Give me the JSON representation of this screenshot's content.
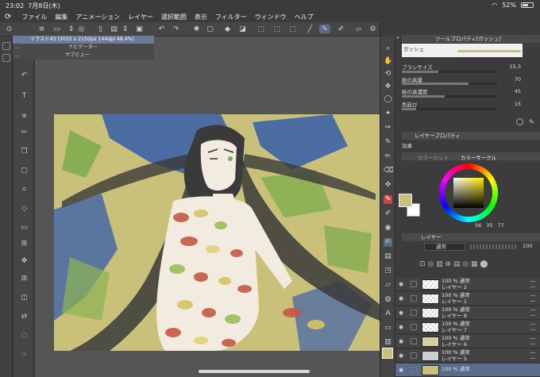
{
  "status": {
    "time": "23:02",
    "date": "7月8日(木)",
    "battery": "52%",
    "battery_level": 0.52
  },
  "menu": [
    "ファイル",
    "編集",
    "アニメーション",
    "レイヤー",
    "選択範囲",
    "表示",
    "フィルター",
    "ウィンドウ",
    "ヘルプ"
  ],
  "document_menu": {
    "active": "イラスト43 (3035 x 2150px 144dpi 48.4%)",
    "navigator": "ナビゲーター",
    "subview": "サブビュー",
    "ellipsis": "..."
  },
  "tool_property": {
    "tab": "ツールプロパティ[ガッシュ]",
    "brush_name": "ガッシュ",
    "rows": [
      {
        "label": "ブラシサイズ",
        "value": "15.3",
        "level": 0.38
      },
      {
        "label": "絵の具量",
        "value": "70",
        "level": 0.7
      },
      {
        "label": "絵の具濃度",
        "value": "45",
        "level": 0.45
      },
      {
        "label": "色延び",
        "value": "15",
        "level": 0.15
      }
    ]
  },
  "layer_property": {
    "tab": "レイヤープロパティ",
    "effect_label": "効果"
  },
  "color": {
    "tab_set": "カラーセット",
    "tab_circle": "カラーサークル",
    "h": "56",
    "s": "35",
    "v": "77",
    "main_color": "#c9c07a",
    "sub_color": "#ffffff"
  },
  "layers_panel": {
    "tab": "レイヤー",
    "blend_mode": "通常",
    "opacity": "100",
    "layers": [
      {
        "line1": "100 % 通常",
        "line2": "レイヤー 2",
        "selected": false
      },
      {
        "line1": "100 % 通常",
        "line2": "レイヤー 1",
        "selected": false
      },
      {
        "line1": "100 % 通常",
        "line2": "レイヤー 8",
        "selected": false
      },
      {
        "line1": "100 % 通常",
        "line2": "レイヤー 7",
        "selected": false
      },
      {
        "line1": "100 % 通常",
        "line2": "レイヤー 6",
        "selected": false
      },
      {
        "line1": "100 % 通常",
        "line2": "レイヤー 5",
        "selected": false
      },
      {
        "line1": "100 % 通常",
        "line2": "",
        "selected": true
      }
    ]
  }
}
